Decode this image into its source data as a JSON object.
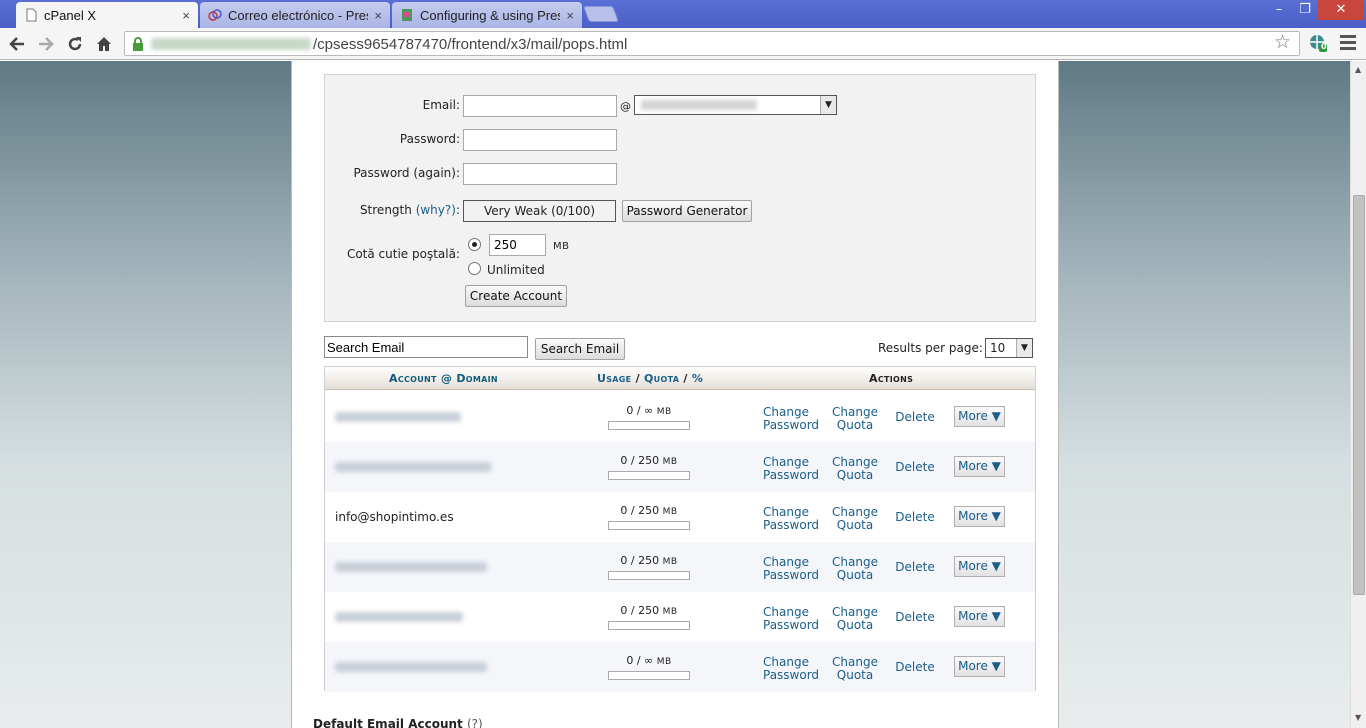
{
  "browser": {
    "tabs": [
      {
        "label": "cPanel X",
        "close": "×"
      },
      {
        "label": "Correo electrónico - Prest",
        "close": "×"
      },
      {
        "label": "Configuring & using Prest",
        "close": "×"
      }
    ],
    "window_controls": {
      "minimize": "–",
      "restore": "❐",
      "close": "✕"
    },
    "url_visible": "/cpsess9654787470/frontend/x3/mail/pops.html",
    "extension_badge": "0"
  },
  "form": {
    "email_label": "Email:",
    "at_sign": "@",
    "password_label": "Password:",
    "password_again_label": "Password (again):",
    "strength_label": "Strength",
    "why_link": "(why?)",
    "colon": ":",
    "strength_value": "Very Weak (0/100)",
    "password_generator_button": "Password Generator",
    "quota_label": "Cotă cutie poştală:",
    "quota_value": "250",
    "quota_unit": "MB",
    "unlimited_label": "Unlimited",
    "create_button": "Create Account"
  },
  "search": {
    "placeholder": "Search Email",
    "button": "Search Email",
    "results_per_page_label": "Results per page:",
    "results_per_page_value": "10"
  },
  "table": {
    "headers": {
      "account": "Account @ Domain",
      "usage": "Usage",
      "sep1": "/",
      "quota": "Quota",
      "sep2": "/",
      "percent": "%",
      "actions": "Actions"
    },
    "rows": [
      {
        "account": "",
        "usage": "0 / ∞",
        "unit": "MB"
      },
      {
        "account": "",
        "usage": "0 / 250",
        "unit": "MB"
      },
      {
        "account": "info@shopintimo.es",
        "usage": "0 / 250",
        "unit": "MB"
      },
      {
        "account": "",
        "usage": "0 / 250",
        "unit": "MB"
      },
      {
        "account": "",
        "usage": "0 / 250",
        "unit": "MB"
      },
      {
        "account": "",
        "usage": "0 / ∞",
        "unit": "MB"
      }
    ],
    "actions": {
      "change_password_1": "Change",
      "change_password_2": "Password",
      "change_quota_1": "Change",
      "change_quota_2": "Quota",
      "delete": "Delete",
      "more": "More ▼"
    }
  },
  "footer": {
    "default_account_title": "Default Email Account",
    "help": "(?)"
  }
}
